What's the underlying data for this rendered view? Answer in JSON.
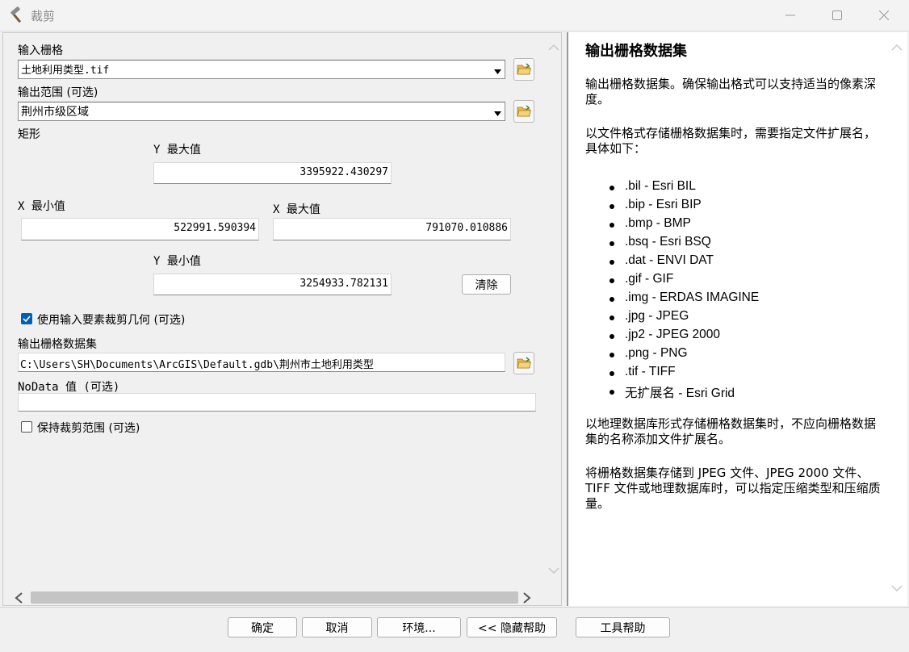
{
  "window": {
    "title": "裁剪"
  },
  "form": {
    "input_raster_label": "输入栅格",
    "input_raster_value": "土地利用类型.tif",
    "output_extent_label": "输出范围 (可选)",
    "output_extent_value": "荆州市级区域",
    "rectangle_label": "矩形",
    "y_max_label": "Y 最大值",
    "y_max_value": "3395922.430297",
    "x_min_label": "X 最小值",
    "x_min_value": "522991.590394",
    "x_max_label": "X 最大值",
    "x_max_value": "791070.010886",
    "y_min_label": "Y 最小值",
    "y_min_value": "3254933.782131",
    "clear_label": "清除",
    "use_input_features_label": "使用输入要素裁剪几何 (可选)",
    "use_input_features_checked": true,
    "output_raster_label": "输出栅格数据集",
    "output_raster_value": "C:\\Users\\SH\\Documents\\ArcGIS\\Default.gdb\\荆州市土地利用类型",
    "nodata_label": "NoData 值 (可选)",
    "nodata_value": "",
    "maintain_extent_label": "保持裁剪范围 (可选)",
    "maintain_extent_checked": false
  },
  "help": {
    "title": "输出栅格数据集",
    "p1": "输出栅格数据集。确保输出格式可以支持适当的像素深度。",
    "p2": "以文件格式存储栅格数据集时，需要指定文件扩展名，具体如下：",
    "formats": [
      ".bil - Esri BIL",
      ".bip - Esri BIP",
      ".bmp - BMP",
      ".bsq - Esri BSQ",
      ".dat - ENVI DAT",
      ".gif - GIF",
      ".img - ERDAS IMAGINE",
      ".jpg - JPEG",
      ".jp2 - JPEG 2000",
      ".png - PNG",
      ".tif - TIFF",
      "无扩展名 - Esri Grid"
    ],
    "p3": "以地理数据库形式存储栅格数据集时，不应向栅格数据集的名称添加文件扩展名。",
    "p4": "将栅格数据集存储到 JPEG 文件、JPEG 2000 文件、TIFF 文件或地理数据库时，可以指定压缩类型和压缩质量。"
  },
  "buttons": {
    "ok": "确定",
    "cancel": "取消",
    "env": "环境...",
    "hide_help": "<< 隐藏帮助",
    "tool_help": "工具帮助"
  },
  "colors": {
    "accent": "#005fb8",
    "pane_border": "#9a9a9a"
  }
}
